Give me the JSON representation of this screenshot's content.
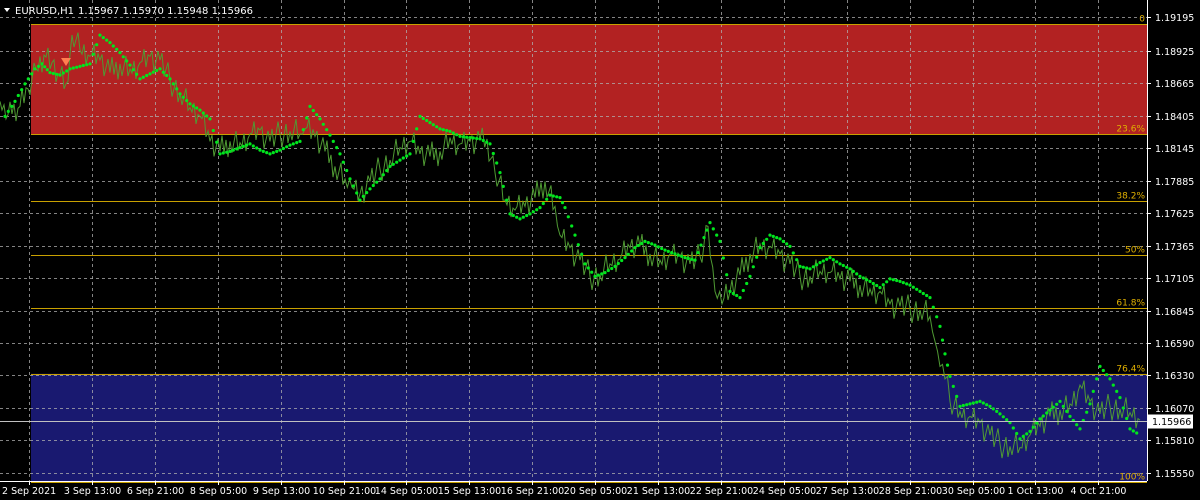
{
  "header": {
    "symbol": "EURUSD,H1",
    "ohlc": "1.15967 1.15970 1.15948 1.15966",
    "menu_icon": "triangle-down-icon"
  },
  "current_price": "1.15966",
  "colors": {
    "background": "#000000",
    "grid": "#b0b0b0",
    "price_series": "#4f9a33",
    "parabolic_sar": "#00e61e",
    "fib_lines": "#c8a000",
    "fib_label": "#e0b000",
    "upper_zone": "#b22222",
    "lower_zone": "#191970",
    "axis_text": "#ffffff",
    "price_tag_bg": "#ffffff",
    "price_tag_text": "#000000",
    "arrow_marker": "#ff7f50"
  },
  "chart_data": {
    "type": "line",
    "x_ticks": [
      "2 Sep 2021",
      "3 Sep 13:00",
      "6 Sep 21:00",
      "8 Sep 05:00",
      "9 Sep 13:00",
      "10 Sep 21:00",
      "14 Sep 05:00",
      "15 Sep 13:00",
      "16 Sep 21:00",
      "20 Sep 05:00",
      "21 Sep 13:00",
      "22 Sep 21:00",
      "24 Sep 05:00",
      "27 Sep 13:00",
      "28 Sep 21:00",
      "30 Sep 05:00",
      "1 Oct 13:00",
      "4 Oct 21:00"
    ],
    "y_ticks": [
      "1.19195",
      "1.18925",
      "1.18665",
      "1.18405",
      "1.18145",
      "1.17885",
      "1.17625",
      "1.17365",
      "1.17105",
      "1.16845",
      "1.16590",
      "1.16330",
      "1.16070",
      "1.15810",
      "1.15550"
    ],
    "ylim": [
      1.1555,
      1.192
    ],
    "fib_levels": [
      {
        "label": "0",
        "price": 1.19137
      },
      {
        "label": "23.6%",
        "price": 1.18256
      },
      {
        "label": "38.2%",
        "price": 1.17726
      },
      {
        "label": "50%",
        "price": 1.17293
      },
      {
        "label": "61.8%",
        "price": 1.16871
      },
      {
        "label": "76.4%",
        "price": 1.16341
      },
      {
        "label": "100%",
        "price": 1.15473
      }
    ],
    "series": [
      {
        "values": [
          [
            0,
            1.1852
          ],
          [
            6,
            1.1838
          ],
          [
            12,
            1.1842
          ],
          [
            20,
            1.1848
          ],
          [
            28,
            1.1862
          ],
          [
            36,
            1.1878
          ],
          [
            44,
            1.1889
          ],
          [
            52,
            1.1883
          ],
          [
            60,
            1.1874
          ],
          [
            66,
            1.1866
          ],
          [
            72,
            1.1905
          ],
          [
            80,
            1.1893
          ],
          [
            90,
            1.1888
          ],
          [
            100,
            1.1885
          ],
          [
            110,
            1.1875
          ],
          [
            120,
            1.1882
          ],
          [
            130,
            1.1878
          ],
          [
            140,
            1.1883
          ],
          [
            150,
            1.1888
          ],
          [
            160,
            1.1885
          ],
          [
            170,
            1.1869
          ],
          [
            180,
            1.1858
          ],
          [
            190,
            1.1847
          ],
          [
            200,
            1.184
          ],
          [
            210,
            1.182
          ],
          [
            220,
            1.1812
          ],
          [
            230,
            1.182
          ],
          [
            240,
            1.1819
          ],
          [
            250,
            1.1826
          ],
          [
            260,
            1.1829
          ],
          [
            270,
            1.182
          ],
          [
            280,
            1.1826
          ],
          [
            290,
            1.1828
          ],
          [
            300,
            1.1826
          ],
          [
            305,
            1.183
          ],
          [
            315,
            1.1824
          ],
          [
            325,
            1.1812
          ],
          [
            335,
            1.18
          ],
          [
            345,
            1.179
          ],
          [
            352,
            1.1783
          ],
          [
            360,
            1.1778
          ],
          [
            370,
            1.1788
          ],
          [
            380,
            1.1798
          ],
          [
            390,
            1.1805
          ],
          [
            400,
            1.1815
          ],
          [
            410,
            1.182
          ],
          [
            420,
            1.181
          ],
          [
            430,
            1.1808
          ],
          [
            440,
            1.1812
          ],
          [
            450,
            1.1823
          ],
          [
            460,
            1.1818
          ],
          [
            470,
            1.182
          ],
          [
            480,
            1.1822
          ],
          [
            487,
            1.1822
          ],
          [
            495,
            1.1795
          ],
          [
            505,
            1.1773
          ],
          [
            515,
            1.1765
          ],
          [
            525,
            1.1768
          ],
          [
            535,
            1.1775
          ],
          [
            545,
            1.1788
          ],
          [
            555,
            1.1768
          ],
          [
            560,
            1.1745
          ],
          [
            570,
            1.1735
          ],
          [
            580,
            1.1725
          ],
          [
            590,
            1.1712
          ],
          [
            600,
            1.1713
          ],
          [
            610,
            1.1722
          ],
          [
            620,
            1.1726
          ],
          [
            630,
            1.1735
          ],
          [
            640,
            1.1736
          ],
          [
            650,
            1.173
          ],
          [
            660,
            1.1725
          ],
          [
            670,
            1.173
          ],
          [
            680,
            1.1728
          ],
          [
            690,
            1.1722
          ],
          [
            700,
            1.1728
          ],
          [
            708,
            1.1752
          ],
          [
            715,
            1.17
          ],
          [
            722,
            1.169
          ],
          [
            730,
            1.17
          ],
          [
            740,
            1.1713
          ],
          [
            750,
            1.173
          ],
          [
            760,
            1.1738
          ],
          [
            770,
            1.1736
          ],
          [
            780,
            1.173
          ],
          [
            790,
            1.1722
          ],
          [
            800,
            1.1712
          ],
          [
            810,
            1.1712
          ],
          [
            820,
            1.1716
          ],
          [
            830,
            1.1715
          ],
          [
            840,
            1.171
          ],
          [
            850,
            1.1708
          ],
          [
            860,
            1.1705
          ],
          [
            870,
            1.1702
          ],
          [
            880,
            1.17
          ],
          [
            890,
            1.169
          ],
          [
            900,
            1.1688
          ],
          [
            910,
            1.1686
          ],
          [
            920,
            1.1685
          ],
          [
            930,
            1.168
          ],
          [
            935,
            1.166
          ],
          [
            940,
            1.164
          ],
          [
            945,
            1.163
          ],
          [
            950,
            1.1612
          ],
          [
            960,
            1.1604
          ],
          [
            970,
            1.16
          ],
          [
            980,
            1.1595
          ],
          [
            990,
            1.1585
          ],
          [
            1000,
            1.1578
          ],
          [
            1010,
            1.1576
          ],
          [
            1020,
            1.1575
          ],
          [
            1030,
            1.1585
          ],
          [
            1040,
            1.1592
          ],
          [
            1050,
            1.16
          ],
          [
            1060,
            1.1605
          ],
          [
            1070,
            1.161
          ],
          [
            1080,
            1.1625
          ],
          [
            1090,
            1.1612
          ],
          [
            1100,
            1.1602
          ],
          [
            1110,
            1.1608
          ],
          [
            1120,
            1.1606
          ],
          [
            1130,
            1.1603
          ],
          [
            1140,
            1.1597
          ]
        ]
      },
      {
        "values": [
          [
            5,
            1.184
          ],
          [
            15,
            1.1852
          ],
          [
            25,
            1.1866
          ],
          [
            35,
            1.1878
          ],
          [
            42,
            1.1882
          ],
          [
            50,
            1.1875
          ],
          [
            60,
            1.1873
          ],
          [
            70,
            1.1878
          ],
          [
            80,
            1.188
          ],
          [
            90,
            1.1882
          ],
          [
            100,
            1.1905
          ],
          [
            110,
            1.1899
          ],
          [
            120,
            1.1891
          ],
          [
            130,
            1.1881
          ],
          [
            140,
            1.187
          ],
          [
            150,
            1.1874
          ],
          [
            160,
            1.1878
          ],
          [
            170,
            1.187
          ],
          [
            180,
            1.1858
          ],
          [
            190,
            1.185
          ],
          [
            200,
            1.1845
          ],
          [
            210,
            1.1838
          ],
          [
            220,
            1.181
          ],
          [
            230,
            1.1812
          ],
          [
            240,
            1.1815
          ],
          [
            250,
            1.1818
          ],
          [
            260,
            1.1813
          ],
          [
            270,
            1.181
          ],
          [
            280,
            1.1813
          ],
          [
            290,
            1.1817
          ],
          [
            300,
            1.182
          ],
          [
            310,
            1.1848
          ],
          [
            320,
            1.1838
          ],
          [
            330,
            1.1825
          ],
          [
            340,
            1.181
          ],
          [
            350,
            1.179
          ],
          [
            360,
            1.1773
          ],
          [
            370,
            1.1782
          ],
          [
            380,
            1.179
          ],
          [
            390,
            1.18
          ],
          [
            400,
            1.1805
          ],
          [
            410,
            1.181
          ],
          [
            420,
            1.184
          ],
          [
            430,
            1.1835
          ],
          [
            440,
            1.183
          ],
          [
            450,
            1.1828
          ],
          [
            460,
            1.1824
          ],
          [
            470,
            1.1823
          ],
          [
            480,
            1.1822
          ],
          [
            490,
            1.1818
          ],
          [
            500,
            1.1795
          ],
          [
            510,
            1.1762
          ],
          [
            520,
            1.1758
          ],
          [
            530,
            1.1762
          ],
          [
            540,
            1.1767
          ],
          [
            550,
            1.1777
          ],
          [
            560,
            1.1775
          ],
          [
            565,
            1.1767
          ],
          [
            575,
            1.1745
          ],
          [
            585,
            1.1722
          ],
          [
            595,
            1.1712
          ],
          [
            605,
            1.1715
          ],
          [
            615,
            1.172
          ],
          [
            625,
            1.1727
          ],
          [
            635,
            1.1735
          ],
          [
            645,
            1.174
          ],
          [
            655,
            1.1737
          ],
          [
            665,
            1.1733
          ],
          [
            675,
            1.173
          ],
          [
            685,
            1.1727
          ],
          [
            695,
            1.1725
          ],
          [
            710,
            1.1755
          ],
          [
            720,
            1.174
          ],
          [
            730,
            1.17
          ],
          [
            740,
            1.1695
          ],
          [
            750,
            1.1712
          ],
          [
            760,
            1.1735
          ],
          [
            770,
            1.1745
          ],
          [
            780,
            1.1742
          ],
          [
            790,
            1.1736
          ],
          [
            800,
            1.172
          ],
          [
            810,
            1.1718
          ],
          [
            820,
            1.1723
          ],
          [
            830,
            1.1727
          ],
          [
            840,
            1.1722
          ],
          [
            850,
            1.1718
          ],
          [
            860,
            1.1712
          ],
          [
            870,
            1.1708
          ],
          [
            880,
            1.1703
          ],
          [
            890,
            1.171
          ],
          [
            900,
            1.1708
          ],
          [
            910,
            1.1705
          ],
          [
            920,
            1.17
          ],
          [
            930,
            1.1695
          ],
          [
            940,
            1.1672
          ],
          [
            945,
            1.165
          ],
          [
            950,
            1.1632
          ],
          [
            960,
            1.1608
          ],
          [
            970,
            1.161
          ],
          [
            980,
            1.1612
          ],
          [
            990,
            1.1608
          ],
          [
            1000,
            1.1602
          ],
          [
            1010,
            1.1595
          ],
          [
            1020,
            1.1582
          ],
          [
            1030,
            1.1588
          ],
          [
            1040,
            1.1598
          ],
          [
            1050,
            1.1605
          ],
          [
            1060,
            1.1612
          ],
          [
            1070,
            1.16
          ],
          [
            1080,
            1.159
          ],
          [
            1090,
            1.161
          ],
          [
            1100,
            1.164
          ],
          [
            1110,
            1.163
          ],
          [
            1120,
            1.1615
          ],
          [
            1130,
            1.159
          ],
          [
            1140,
            1.1585
          ]
        ]
      }
    ],
    "arrow_marker": {
      "x": 66,
      "price": 1.18835
    }
  }
}
